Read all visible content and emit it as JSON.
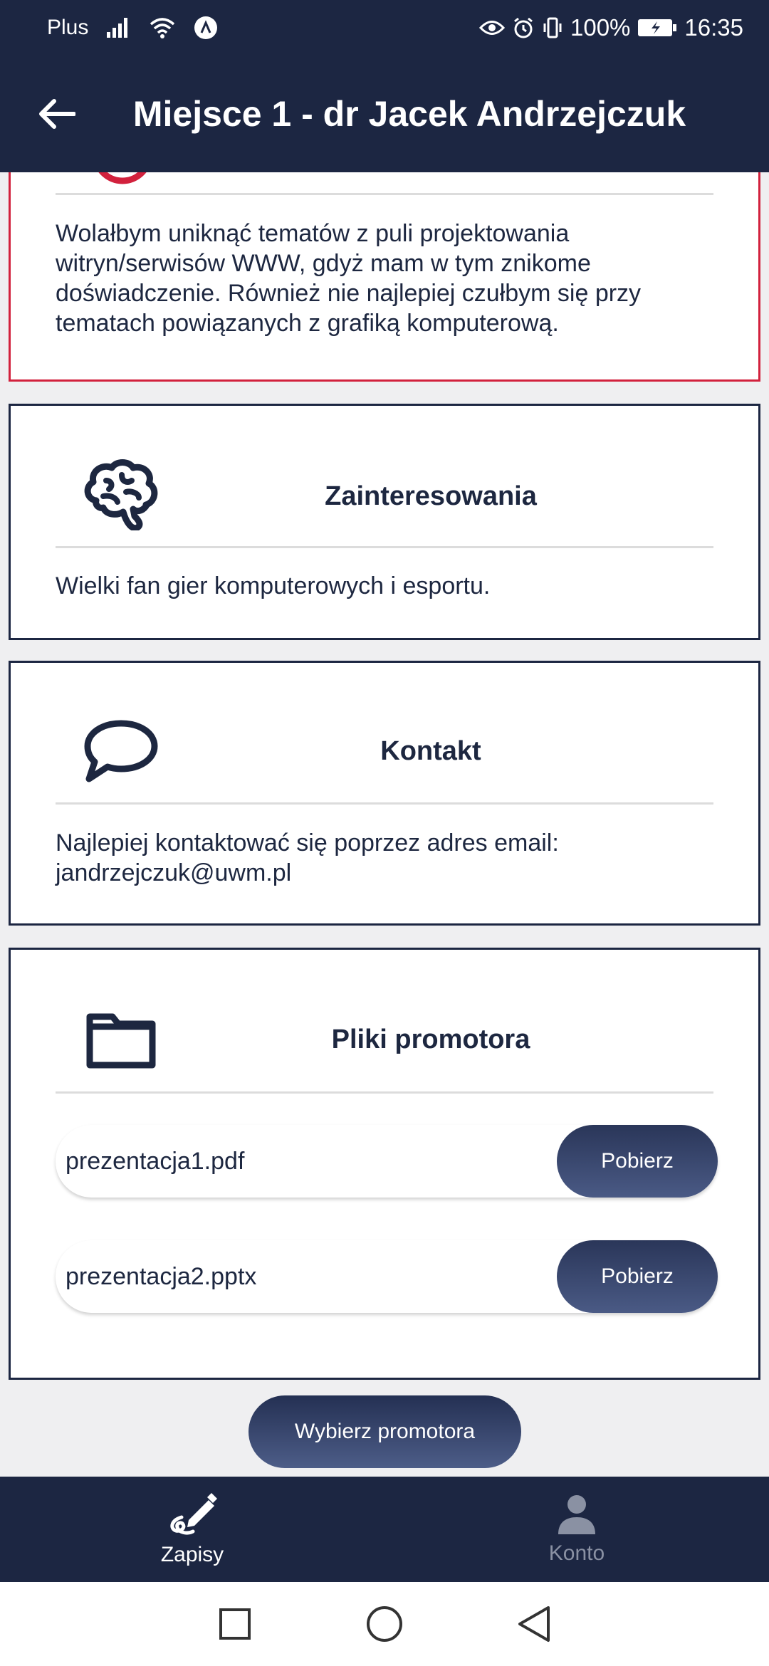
{
  "status_bar": {
    "carrier": "Plus",
    "battery": "100%",
    "time": "16:35"
  },
  "app_bar": {
    "title": "Miejsce 1 - dr Jacek Andrzejczuk",
    "back_icon": "arrow-left-icon"
  },
  "cards": {
    "preferences": {
      "text": "Wolałbym uniknąć tematów z puli projektowania witryn/serwisów WWW, gdyż mam w tym znikome doświadczenie. Również nie najlepiej czułbym się przy tematach powiązanych z grafiką komputerową.",
      "accent": "#d2213d"
    },
    "interests": {
      "title": "Zainteresowania",
      "icon": "brain-icon",
      "text": "Wielki fan gier komputerowych i esportu."
    },
    "contact": {
      "title": "Kontakt",
      "icon": "speech-bubble-icon",
      "text_line1": "Najlepiej kontaktować się poprzez adres email:",
      "text_line2": "jandrzejczuk@uwm.pl"
    },
    "files": {
      "title": "Pliki promotora",
      "icon": "folder-icon",
      "items": [
        {
          "name": "prezentacja1.pdf",
          "button": "Pobierz"
        },
        {
          "name": "prezentacja2.pptx",
          "button": "Pobierz"
        }
      ]
    }
  },
  "primary_button": "Wybierz promotora",
  "bottom_nav": [
    {
      "label": "Zapisy",
      "icon": "pen-icon",
      "active": true
    },
    {
      "label": "Konto",
      "icon": "person-icon",
      "active": false
    }
  ],
  "colors": {
    "navy": "#1c2642",
    "accent_red": "#d2213d",
    "background": "#efeff1"
  }
}
